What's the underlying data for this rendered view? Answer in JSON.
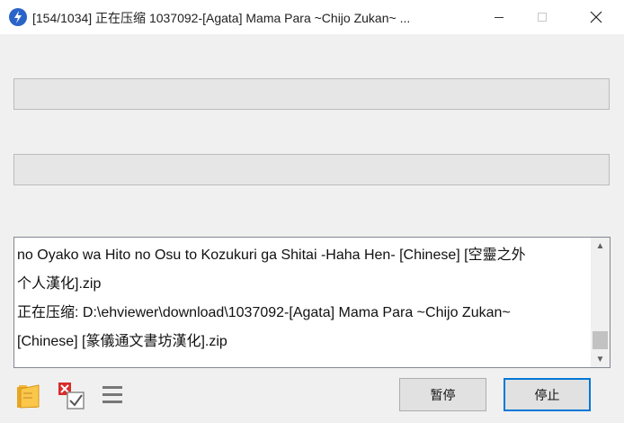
{
  "window": {
    "title": "[154/1034] 正在压缩 1037092-[Agata] Mama Para ~Chijo Zukan~ ..."
  },
  "icons": {
    "app": "app-icon",
    "minimize": "minimize-icon",
    "maximize": "maximize-icon",
    "close": "close-icon",
    "folder": "open-folder-icon",
    "check": "checklist-icon",
    "menu": "menu-icon"
  },
  "progress": {
    "bar1": 0,
    "bar2": 0
  },
  "log": {
    "lines": [
      "no Oyako wa Hito no Osu to Kozukuri ga Shitai -Haha Hen- [Chinese] [空靈之外",
      "个人漢化].zip",
      "正在压缩: D:\\ehviewer\\download\\1037092-[Agata] Mama Para ~Chijo Zukan~",
      "[Chinese] [篆儀通文書坊漢化].zip"
    ]
  },
  "buttons": {
    "pause": "暂停",
    "stop": "停止"
  },
  "colors": {
    "accent": "#0078d7",
    "app_icon": "#2b64c8",
    "progress_fill": "#06b025"
  }
}
